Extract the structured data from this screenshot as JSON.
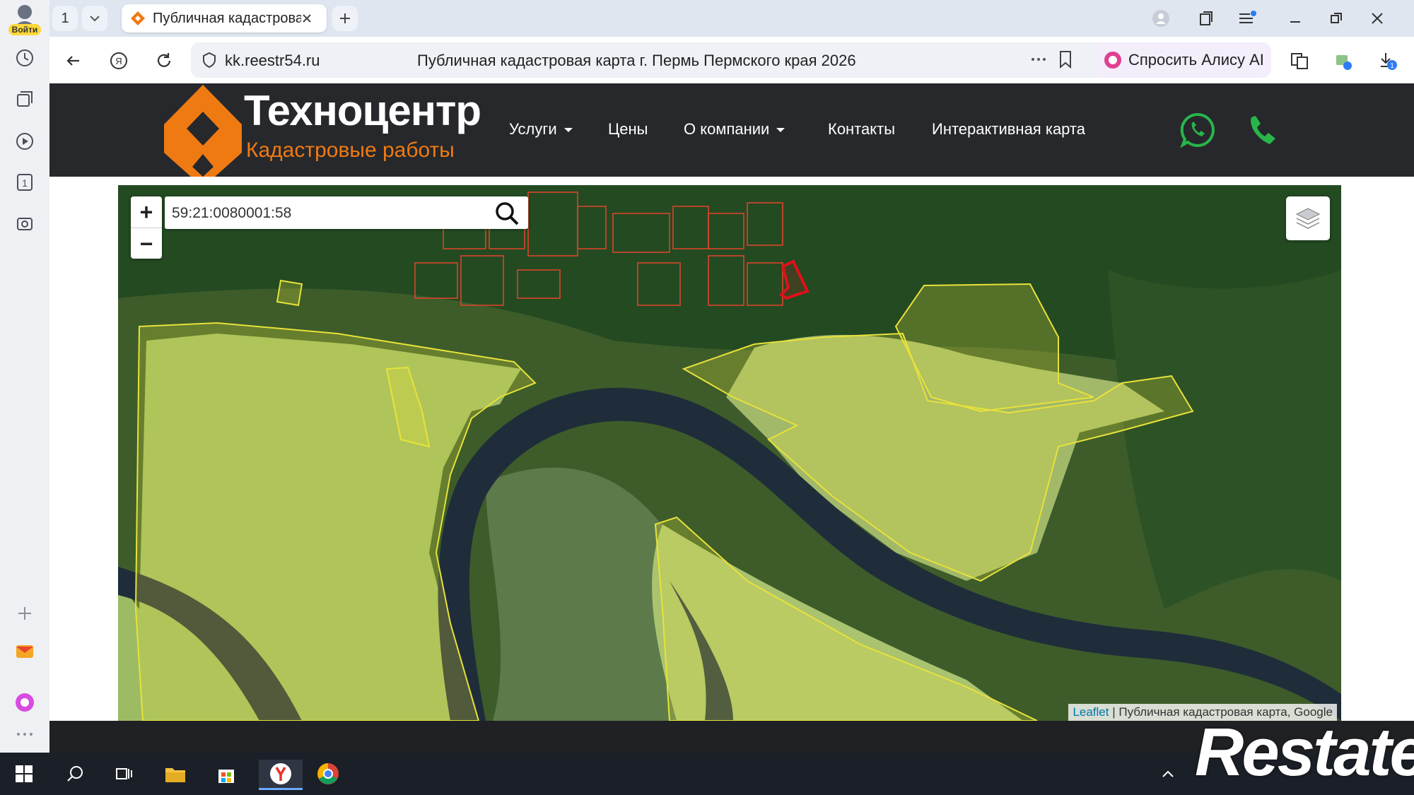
{
  "browser": {
    "profile_label": "Войти",
    "tab_count": "1",
    "active_tab_title": "Публичная кадастрова",
    "url_domain": "kk.reestr54.ru",
    "page_title": "Публичная кадастровая карта г. Пермь Пермского края 2026",
    "alice_label": "Спросить Алису AI",
    "downloads_badge": "1"
  },
  "site": {
    "logo_title": "Техноцентр",
    "logo_subtitle": "Кадастровые работы",
    "nav": [
      {
        "label": "Услуги",
        "dropdown": true
      },
      {
        "label": "Цены",
        "dropdown": false
      },
      {
        "label": "О компании",
        "dropdown": true
      },
      {
        "label": "Контакты",
        "dropdown": false
      },
      {
        "label": "Интерактивная карта",
        "dropdown": false
      }
    ],
    "whatsapp_icon": "whatsapp-icon",
    "phone_icon": "phone-icon"
  },
  "map": {
    "search_value": "59:21:0080001:58",
    "zoom_in": "+",
    "zoom_out": "−",
    "attribution_link": "Leaflet",
    "attribution_text": " | Публичная кадастровая карта, Google",
    "parcel_outline_color": "#e8e23a",
    "selected_parcel_color": "#e0101a",
    "small_parcel_color": "#d9462a"
  },
  "colors": {
    "header_bg": "#26282c",
    "accent_orange": "#f07a12",
    "whatsapp_green": "#29b54a"
  },
  "watermark": "Restate"
}
